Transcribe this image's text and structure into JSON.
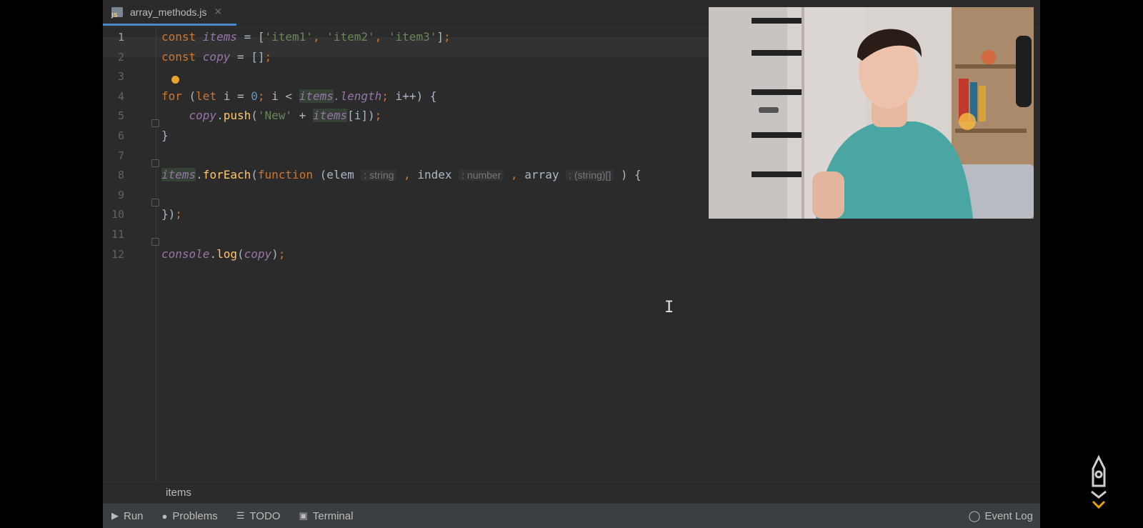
{
  "tab": {
    "filename": "array_methods.js",
    "icon_text": "JS"
  },
  "editor": {
    "line_numbers": [
      "1",
      "2",
      "3",
      "4",
      "5",
      "6",
      "7",
      "8",
      "9",
      "10",
      "11",
      "12"
    ],
    "lines": [
      {
        "segments": [
          {
            "t": "const ",
            "c": "kw"
          },
          {
            "t": "items",
            "c": "var"
          },
          {
            "t": " = [",
            "c": ""
          },
          {
            "t": "'item1'",
            "c": "str"
          },
          {
            "t": ", ",
            "c": "kw"
          },
          {
            "t": "'item2'",
            "c": "str"
          },
          {
            "t": ", ",
            "c": "kw"
          },
          {
            "t": "'item3'",
            "c": "str"
          },
          {
            "t": "]",
            "c": ""
          },
          {
            "t": ";",
            "c": "kw"
          }
        ]
      },
      {
        "segments": [
          {
            "t": "const ",
            "c": "kw"
          },
          {
            "t": "copy",
            "c": "var"
          },
          {
            "t": " = []",
            "c": ""
          },
          {
            "t": ";",
            "c": "kw"
          }
        ]
      },
      {
        "segments": []
      },
      {
        "segments": [
          {
            "t": "for ",
            "c": "kw"
          },
          {
            "t": "(",
            "c": ""
          },
          {
            "t": "let ",
            "c": "kw"
          },
          {
            "t": "i = ",
            "c": ""
          },
          {
            "t": "0",
            "c": "num"
          },
          {
            "t": "; ",
            "c": "kw"
          },
          {
            "t": "i < ",
            "c": ""
          },
          {
            "t": "items",
            "c": "var hl"
          },
          {
            "t": ".length",
            "c": "var"
          },
          {
            "t": "; ",
            "c": "kw"
          },
          {
            "t": "i++) {",
            "c": ""
          }
        ]
      },
      {
        "segments": [
          {
            "t": "    ",
            "c": ""
          },
          {
            "t": "copy",
            "c": "var"
          },
          {
            "t": ".",
            "c": ""
          },
          {
            "t": "push",
            "c": "fn"
          },
          {
            "t": "(",
            "c": ""
          },
          {
            "t": "'New'",
            "c": "str"
          },
          {
            "t": " + ",
            "c": ""
          },
          {
            "t": "items",
            "c": "var hl"
          },
          {
            "t": "[i])",
            "c": ""
          },
          {
            "t": ";",
            "c": "kw"
          }
        ]
      },
      {
        "segments": [
          {
            "t": "}",
            "c": ""
          }
        ]
      },
      {
        "segments": []
      },
      {
        "segments": [
          {
            "t": "items",
            "c": "var hl"
          },
          {
            "t": ".",
            "c": ""
          },
          {
            "t": "forEach",
            "c": "fn"
          },
          {
            "t": "(",
            "c": ""
          },
          {
            "t": "function ",
            "c": "kw"
          },
          {
            "t": "(elem ",
            "c": ""
          },
          {
            "t": ": string",
            "c": "hint"
          },
          {
            "t": " ",
            "c": ""
          },
          {
            "t": ",",
            "c": "kw"
          },
          {
            "t": " index ",
            "c": ""
          },
          {
            "t": ": number",
            "c": "hint"
          },
          {
            "t": " ",
            "c": ""
          },
          {
            "t": ",",
            "c": "kw"
          },
          {
            "t": " array ",
            "c": ""
          },
          {
            "t": ": (string)[]",
            "c": "hint"
          },
          {
            "t": " ) {",
            "c": ""
          }
        ]
      },
      {
        "segments": []
      },
      {
        "segments": [
          {
            "t": "})",
            "c": ""
          },
          {
            "t": ";",
            "c": "kw"
          }
        ]
      },
      {
        "segments": []
      },
      {
        "segments": [
          {
            "t": "console",
            "c": "var"
          },
          {
            "t": ".",
            "c": ""
          },
          {
            "t": "log",
            "c": "fn"
          },
          {
            "t": "(",
            "c": ""
          },
          {
            "t": "copy",
            "c": "var"
          },
          {
            "t": ")",
            "c": ""
          },
          {
            "t": ";",
            "c": "kw"
          }
        ]
      }
    ]
  },
  "breadcrumb": {
    "text": "items"
  },
  "statusbar": {
    "run": "Run",
    "problems": "Problems",
    "todo": "TODO",
    "terminal": "Terminal",
    "event_log": "Event Log"
  },
  "colors": {
    "accent": "#4a88c7",
    "background": "#2b2b2b",
    "statusbar": "#3c3f41"
  }
}
